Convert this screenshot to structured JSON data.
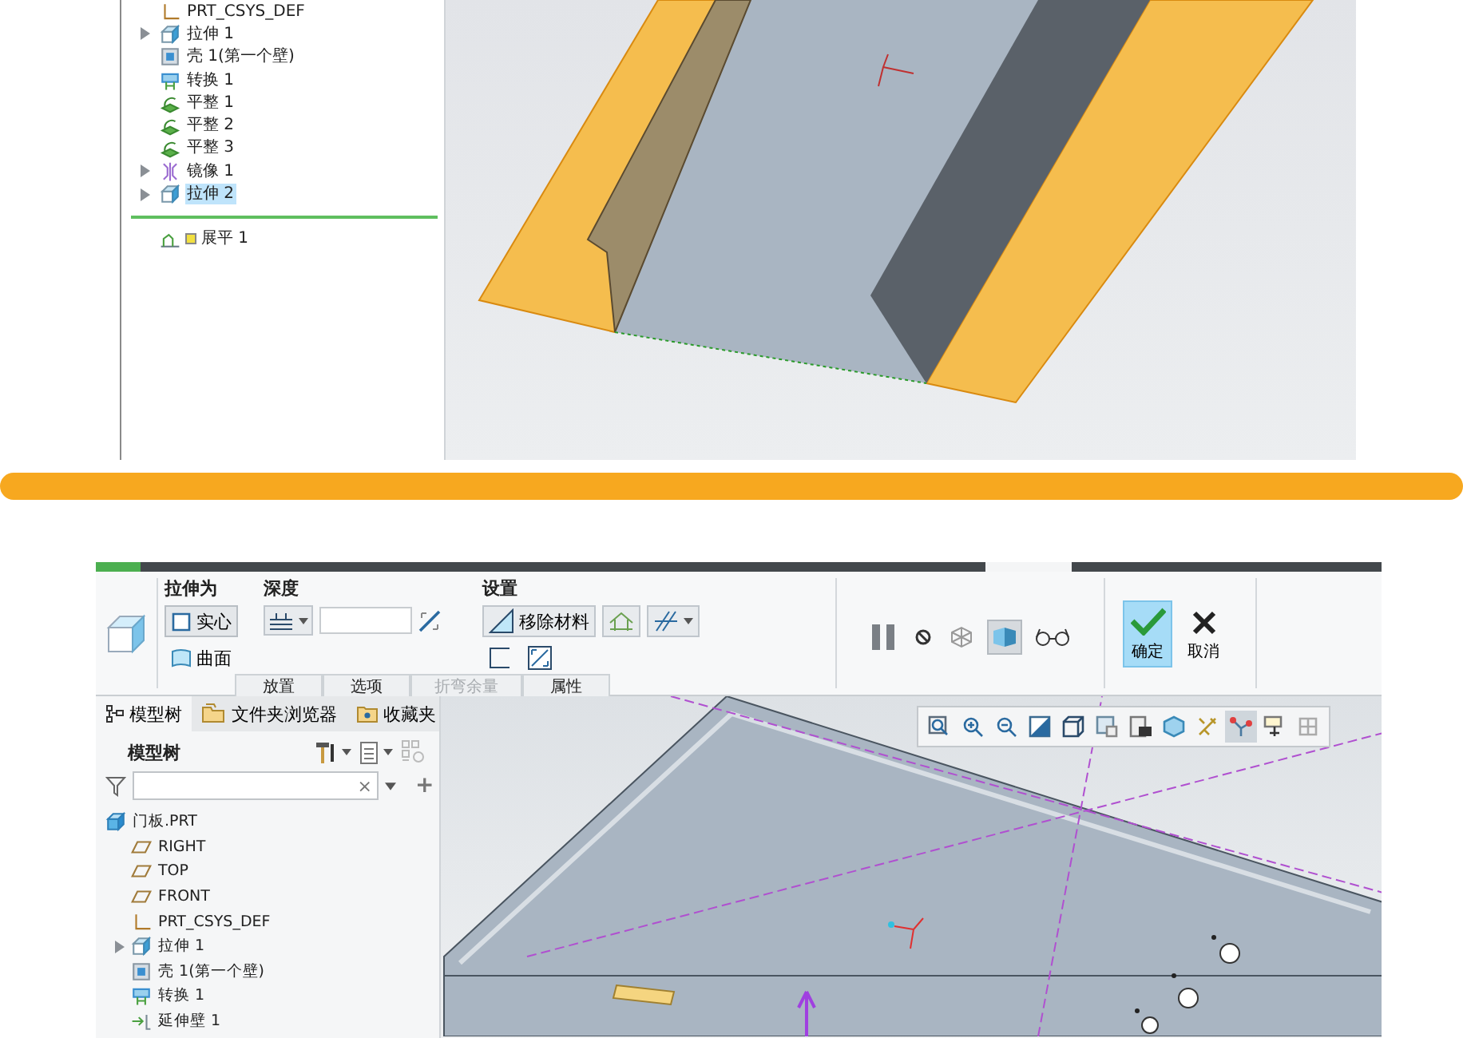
{
  "top_tree": {
    "items": [
      {
        "label": "PRT_CSYS_DEF",
        "kind": "csys",
        "expandable": false,
        "selected": false
      },
      {
        "label": "拉伸 1",
        "kind": "extrude",
        "expandable": true,
        "selected": false
      },
      {
        "label": "壳 1(第一个壁)",
        "kind": "shell",
        "expandable": false,
        "selected": false
      },
      {
        "label": "转换 1",
        "kind": "convert",
        "expandable": false,
        "selected": false
      },
      {
        "label": "平整 1",
        "kind": "flat",
        "expandable": false,
        "selected": false
      },
      {
        "label": "平整 2",
        "kind": "flat",
        "expandable": false,
        "selected": false
      },
      {
        "label": "平整 3",
        "kind": "flat",
        "expandable": false,
        "selected": false
      },
      {
        "label": "镜像 1",
        "kind": "mirror",
        "expandable": true,
        "selected": false
      },
      {
        "label": "拉伸 2",
        "kind": "extrude",
        "expandable": true,
        "selected": true
      }
    ],
    "insert_item": {
      "label": "展平 1",
      "kind": "flatten"
    }
  },
  "ribbon": {
    "extrude_as": {
      "title": "拉伸为",
      "options": [
        {
          "label": "实心",
          "kind": "solid",
          "selected": true
        },
        {
          "label": "曲面",
          "kind": "surface",
          "selected": false
        }
      ]
    },
    "depth": {
      "title": "深度"
    },
    "settings": {
      "title": "设置",
      "remove_material": "移除材料"
    },
    "tabs": [
      {
        "label": "放置",
        "disabled": false
      },
      {
        "label": "选项",
        "disabled": false
      },
      {
        "label": "折弯余量",
        "disabled": true
      },
      {
        "label": "属性",
        "disabled": false
      }
    ],
    "preview_tools": [
      {
        "kind": "pause",
        "selected": false
      },
      {
        "kind": "no-preview",
        "selected": false
      },
      {
        "kind": "wire-preview",
        "selected": false
      },
      {
        "kind": "shaded-preview",
        "selected": true
      },
      {
        "kind": "glasses",
        "selected": false
      }
    ],
    "actions": [
      {
        "label": "确定",
        "kind": "ok",
        "selected": true
      },
      {
        "label": "取消",
        "kind": "cancel",
        "selected": false
      }
    ]
  },
  "navigator": {
    "tabs": [
      {
        "label": "模型树",
        "kind": "tree",
        "selected": true
      },
      {
        "label": "文件夹浏览器",
        "kind": "folder",
        "selected": false
      },
      {
        "label": "收藏夹",
        "kind": "favorites",
        "selected": false
      }
    ],
    "heading": "模型树",
    "filter": {
      "clear": "×",
      "add": "+"
    },
    "tree": [
      {
        "label": "门板.PRT",
        "kind": "part",
        "expandable": false,
        "children": [
          {
            "label": "RIGHT",
            "kind": "datum_plane",
            "expandable": false
          },
          {
            "label": "TOP",
            "kind": "datum_plane",
            "expandable": false
          },
          {
            "label": "FRONT",
            "kind": "datum_plane",
            "expandable": false
          },
          {
            "label": "PRT_CSYS_DEF",
            "kind": "csys",
            "expandable": false
          },
          {
            "label": "拉伸 1",
            "kind": "extrude",
            "expandable": true
          },
          {
            "label": "壳 1(第一个壁)",
            "kind": "shell",
            "expandable": false
          },
          {
            "label": "转换 1",
            "kind": "convert",
            "expandable": false
          },
          {
            "label": "延伸壁 1",
            "kind": "extend_wall",
            "expandable": false
          }
        ]
      }
    ]
  },
  "view_toolbar": [
    {
      "kind": "zoom-fit",
      "selected": false
    },
    {
      "kind": "zoom-in",
      "selected": false
    },
    {
      "kind": "zoom-out",
      "selected": false
    },
    {
      "kind": "repaint",
      "selected": false
    },
    {
      "kind": "display-style",
      "selected": false
    },
    {
      "kind": "saved-views",
      "selected": false
    },
    {
      "kind": "view-manager",
      "selected": false
    },
    {
      "kind": "perspective",
      "selected": false
    },
    {
      "kind": "datum-display",
      "selected": false
    },
    {
      "kind": "annotation",
      "selected": true
    },
    {
      "kind": "spin-center",
      "selected": false
    },
    {
      "kind": "appearance",
      "selected": false
    }
  ]
}
